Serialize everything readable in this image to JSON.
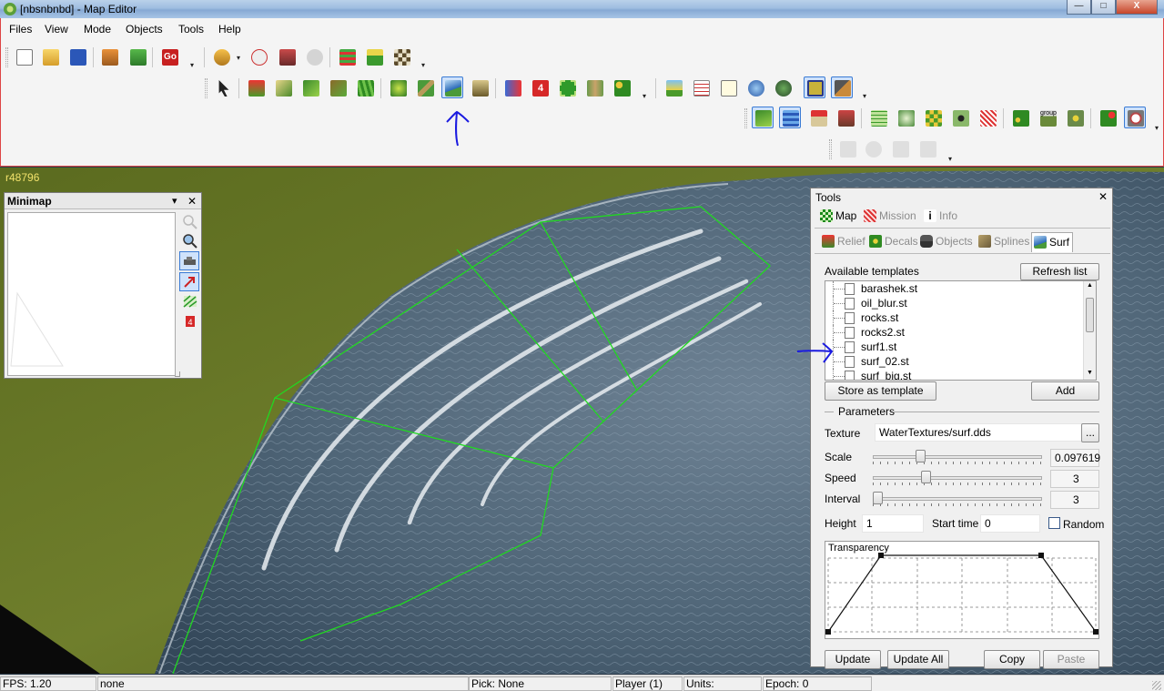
{
  "window": {
    "title": "[nbsnbnbd] - Map Editor",
    "controls": {
      "minimize": "—",
      "maximize": "□",
      "close": "X"
    }
  },
  "menu": [
    "Files",
    "View",
    "Mode",
    "Objects",
    "Tools",
    "Help"
  ],
  "toolbar": {
    "row1_icons": [
      "new-file-icon",
      "open-folder-icon",
      "save-disk-icon",
      "home-icon",
      "shield-check-icon",
      "go-icon",
      "undo-icon",
      "replay-icon",
      "unit-icon",
      "disabled-icon",
      "grid-red-icon",
      "grid-green-icon",
      "checker-icon"
    ],
    "go_label": "Go",
    "row2_icons": [
      "pointer-icon",
      "relief-raise-icon",
      "relief-smooth-icon",
      "relief-paint-icon",
      "relief-brush-icon",
      "relief-grass-icon",
      "tree-icon",
      "road-icon",
      "surf-wave-icon",
      "tank-icon",
      "units-icon",
      "flag-4-icon",
      "zone-icon",
      "soldiers-icon",
      "bushes-icon",
      "landscape-icon",
      "list-icon",
      "comment-icon",
      "gear-icon",
      "bug-icon",
      "frame-icon",
      "hammer-icon"
    ],
    "row3_icons": [
      "terrain-icon",
      "water-icon",
      "house-icon",
      "building-icon",
      "grid-icon",
      "globe-icon",
      "tiles-icon",
      "eye-icon",
      "hatch-icon",
      "dots-icon",
      "group-icon",
      "stars-icon",
      "spots-icon",
      "gauge-icon"
    ],
    "row3_group_label": "group",
    "row4_icons": [
      "disabled-a-icon",
      "disabled-b-icon",
      "disabled-c-icon",
      "disabled-d-icon"
    ],
    "flag_number": "4"
  },
  "viewport": {
    "revision": "r48796"
  },
  "minimap": {
    "title": "Minimap",
    "pin": "▾",
    "close": "✕",
    "buttons": [
      "zoom-out-icon",
      "zoom-in-icon",
      "tank-icon",
      "arrow-icon",
      "hatch-icon",
      "flag-icon"
    ],
    "flag_number": "4"
  },
  "tools": {
    "title": "Tools",
    "close": "✕",
    "main_tabs": [
      {
        "label": "Map",
        "state": "selected"
      },
      {
        "label": "Mission",
        "state": "inactive"
      },
      {
        "label": "Info",
        "state": "inactive"
      }
    ],
    "sub_tabs": [
      {
        "label": "Relief",
        "state": "inactive"
      },
      {
        "label": "Decals",
        "state": "inactive"
      },
      {
        "label": "Objects",
        "state": "inactive"
      },
      {
        "label": "Splines",
        "state": "inactive"
      },
      {
        "label": "Surf",
        "state": "selected"
      }
    ],
    "available_templates_label": "Available templates",
    "refresh_button": "Refresh list",
    "templates": [
      "barashek.st",
      "oil_blur.st",
      "rocks.st",
      "rocks2.st",
      "surf1.st",
      "surf_02.st",
      "surf_big.st"
    ],
    "store_button": "Store as template",
    "add_button": "Add",
    "parameters_label": "Parameters",
    "texture_label": "Texture",
    "texture_value": "WaterTextures/surf.dds",
    "browse_button": "...",
    "scale_label": "Scale",
    "scale_value": "0.097619",
    "scale_level": 0.27,
    "speed_label": "Speed",
    "speed_value": "3",
    "speed_level": 0.3,
    "interval_label": "Interval",
    "interval_value": "3",
    "interval_level": 0.0,
    "height_label": "Height",
    "height_value": "1",
    "start_time_label": "Start time",
    "start_time_value": "0",
    "random_label": "Random",
    "transparency_label": "Transparency",
    "update_button": "Update",
    "update_all_button": "Update All",
    "copy_button": "Copy",
    "paste_button": "Paste"
  },
  "statusbar": {
    "fps": "FPS: 1.20",
    "mode": "none",
    "pick": "Pick: None",
    "player": "Player (1)",
    "units": "Units:",
    "epoch": "Epoch: 0"
  },
  "colors": {
    "annotation": "#1a1ae0",
    "selection_outline": "#21d821",
    "grass": "#6b7a2a",
    "water": "#4a6378"
  }
}
